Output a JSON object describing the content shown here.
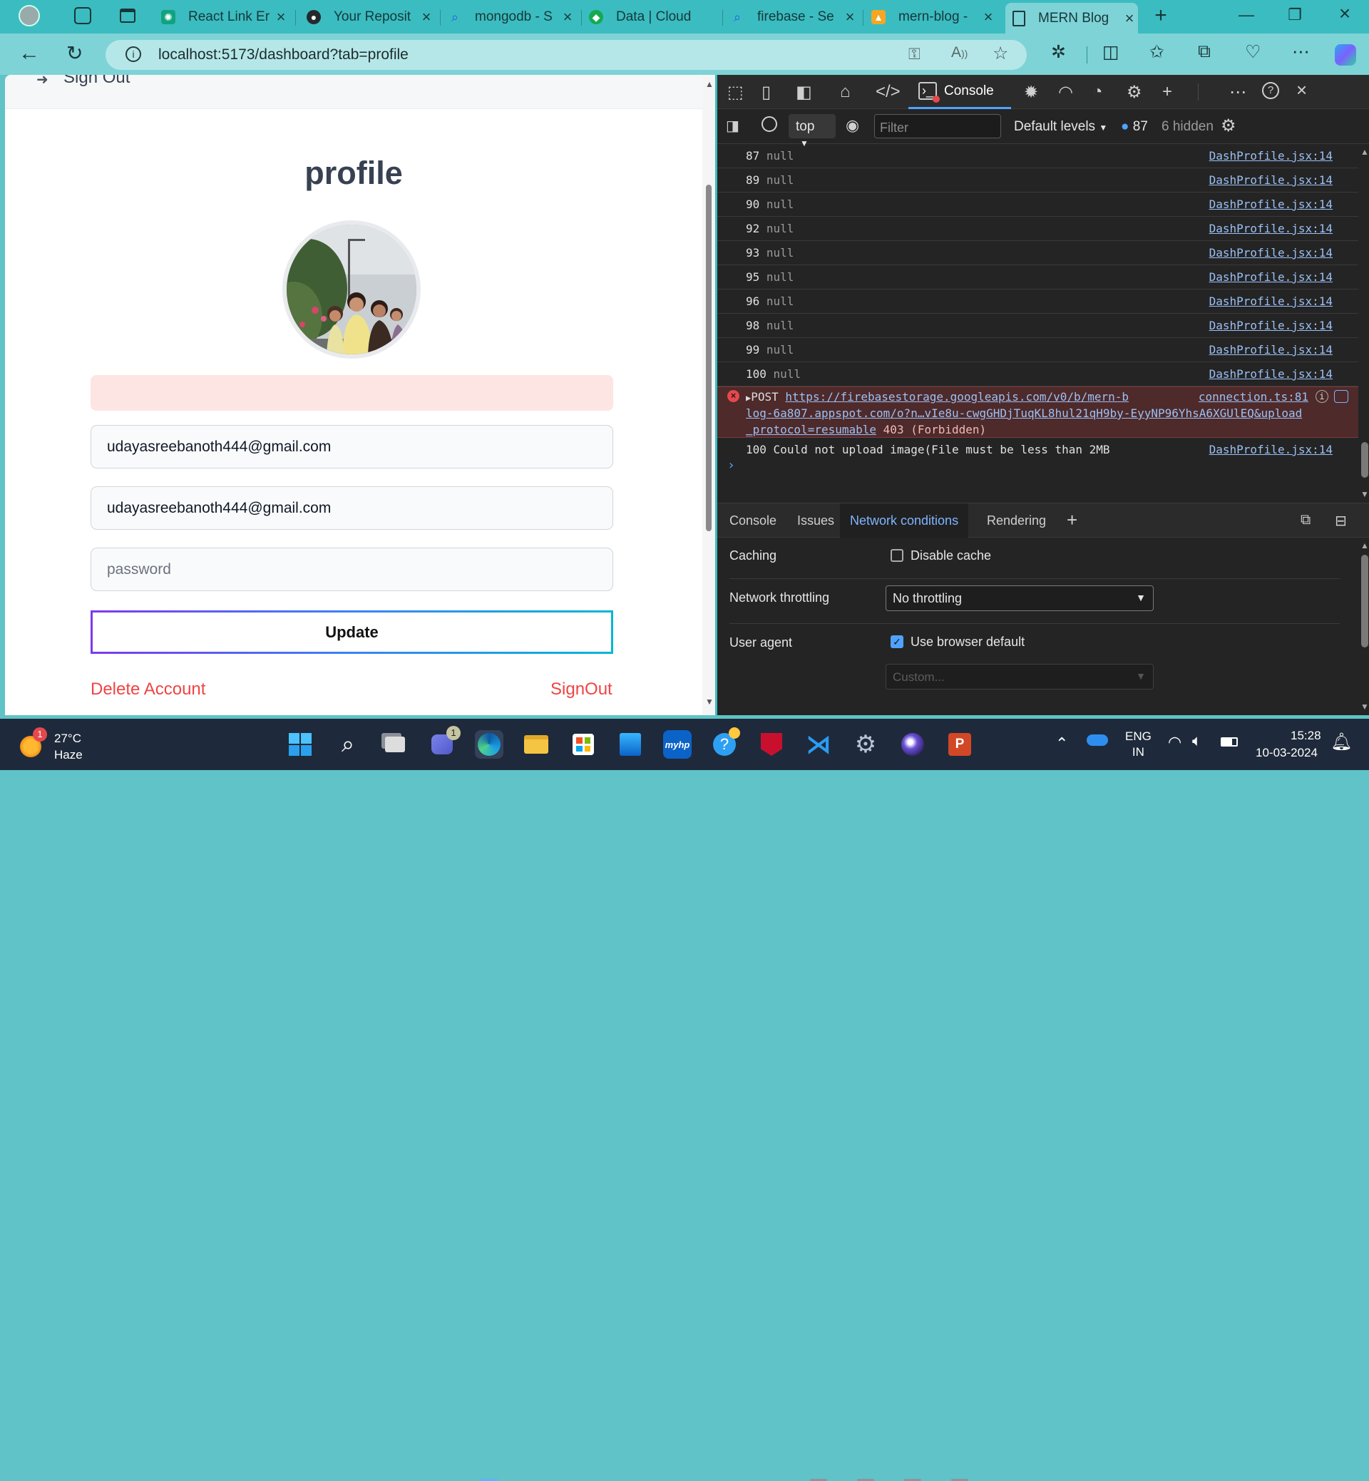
{
  "browser": {
    "tabs": [
      {
        "title": "React Link Er",
        "icon": "chatgpt-icon",
        "color": "#10a37f"
      },
      {
        "title": "Your Reposit",
        "icon": "github-icon",
        "color": "#24292e"
      },
      {
        "title": "mongodb - S",
        "icon": "search-icon",
        "color": "#3b82f6"
      },
      {
        "title": "Data | Cloud",
        "icon": "mongodb-icon",
        "color": "#13aa52"
      },
      {
        "title": "firebase - Se",
        "icon": "search-icon",
        "color": "#3b82f6"
      },
      {
        "title": "mern-blog -",
        "icon": "firebase-icon",
        "color": "#f5a623"
      },
      {
        "title": "MERN Blog",
        "icon": "page-icon",
        "color": "#ffffff"
      }
    ],
    "url": "localhost:5173/dashboard?tab=profile"
  },
  "page": {
    "top_link": "Sign Out",
    "title": "profile",
    "username_value": "udayasreebanoth444@gmail.com",
    "email_value": "udayasreebanoth444@gmail.com",
    "password_placeholder": "password",
    "update_label": "Update",
    "delete_label": "Delete Account",
    "signout_label": "SignOut"
  },
  "devtools": {
    "main_tab": "Console",
    "context": "top",
    "filter_placeholder": "Filter",
    "levels": "Default levels",
    "message_count": "87",
    "hidden": "6 hidden",
    "log_rows": [
      {
        "num": "87",
        "msg": "null",
        "src": "DashProfile.jsx:14"
      },
      {
        "num": "89",
        "msg": "null",
        "src": "DashProfile.jsx:14"
      },
      {
        "num": "90",
        "msg": "null",
        "src": "DashProfile.jsx:14"
      },
      {
        "num": "92",
        "msg": "null",
        "src": "DashProfile.jsx:14"
      },
      {
        "num": "93",
        "msg": "null",
        "src": "DashProfile.jsx:14"
      },
      {
        "num": "95",
        "msg": "null",
        "src": "DashProfile.jsx:14"
      },
      {
        "num": "96",
        "msg": "null",
        "src": "DashProfile.jsx:14"
      },
      {
        "num": "98",
        "msg": "null",
        "src": "DashProfile.jsx:14"
      },
      {
        "num": "99",
        "msg": "null",
        "src": "DashProfile.jsx:14"
      },
      {
        "num": "100",
        "msg": "null",
        "src": "DashProfile.jsx:14"
      }
    ],
    "error": {
      "method": "POST",
      "url_line1": "https://firebasestorage.googleapis.com/v0/b/mern-b",
      "url_line2": "log-6a807.appspot.com/o?n…vIe8u-cwgGHDjTuqKL8hul21qH9by-EyyNP96YhsA6XGUlEQ&upload",
      "url_line3": "_protocol=resumable",
      "status": "403 (Forbidden)",
      "src": "connection.ts:81"
    },
    "final_row": {
      "num": "100",
      "msg": "Could not upload image(File must be less than 2MB",
      "src": "DashProfile.jsx:14"
    },
    "drawer_tabs": [
      "Console",
      "Issues",
      "Network conditions",
      "Rendering"
    ],
    "network": {
      "caching_label": "Caching",
      "disable_cache": "Disable cache",
      "throttling_label": "Network throttling",
      "throttling_value": "No throttling",
      "ua_label": "User agent",
      "ua_default": "Use browser default",
      "custom_placeholder": "Custom..."
    }
  },
  "taskbar": {
    "weather_temp": "27°C",
    "weather_desc": "Haze",
    "weather_badge": "1",
    "teams_badge": "1",
    "lang1": "ENG",
    "lang2": "IN",
    "time": "15:28",
    "date": "10-03-2024"
  }
}
